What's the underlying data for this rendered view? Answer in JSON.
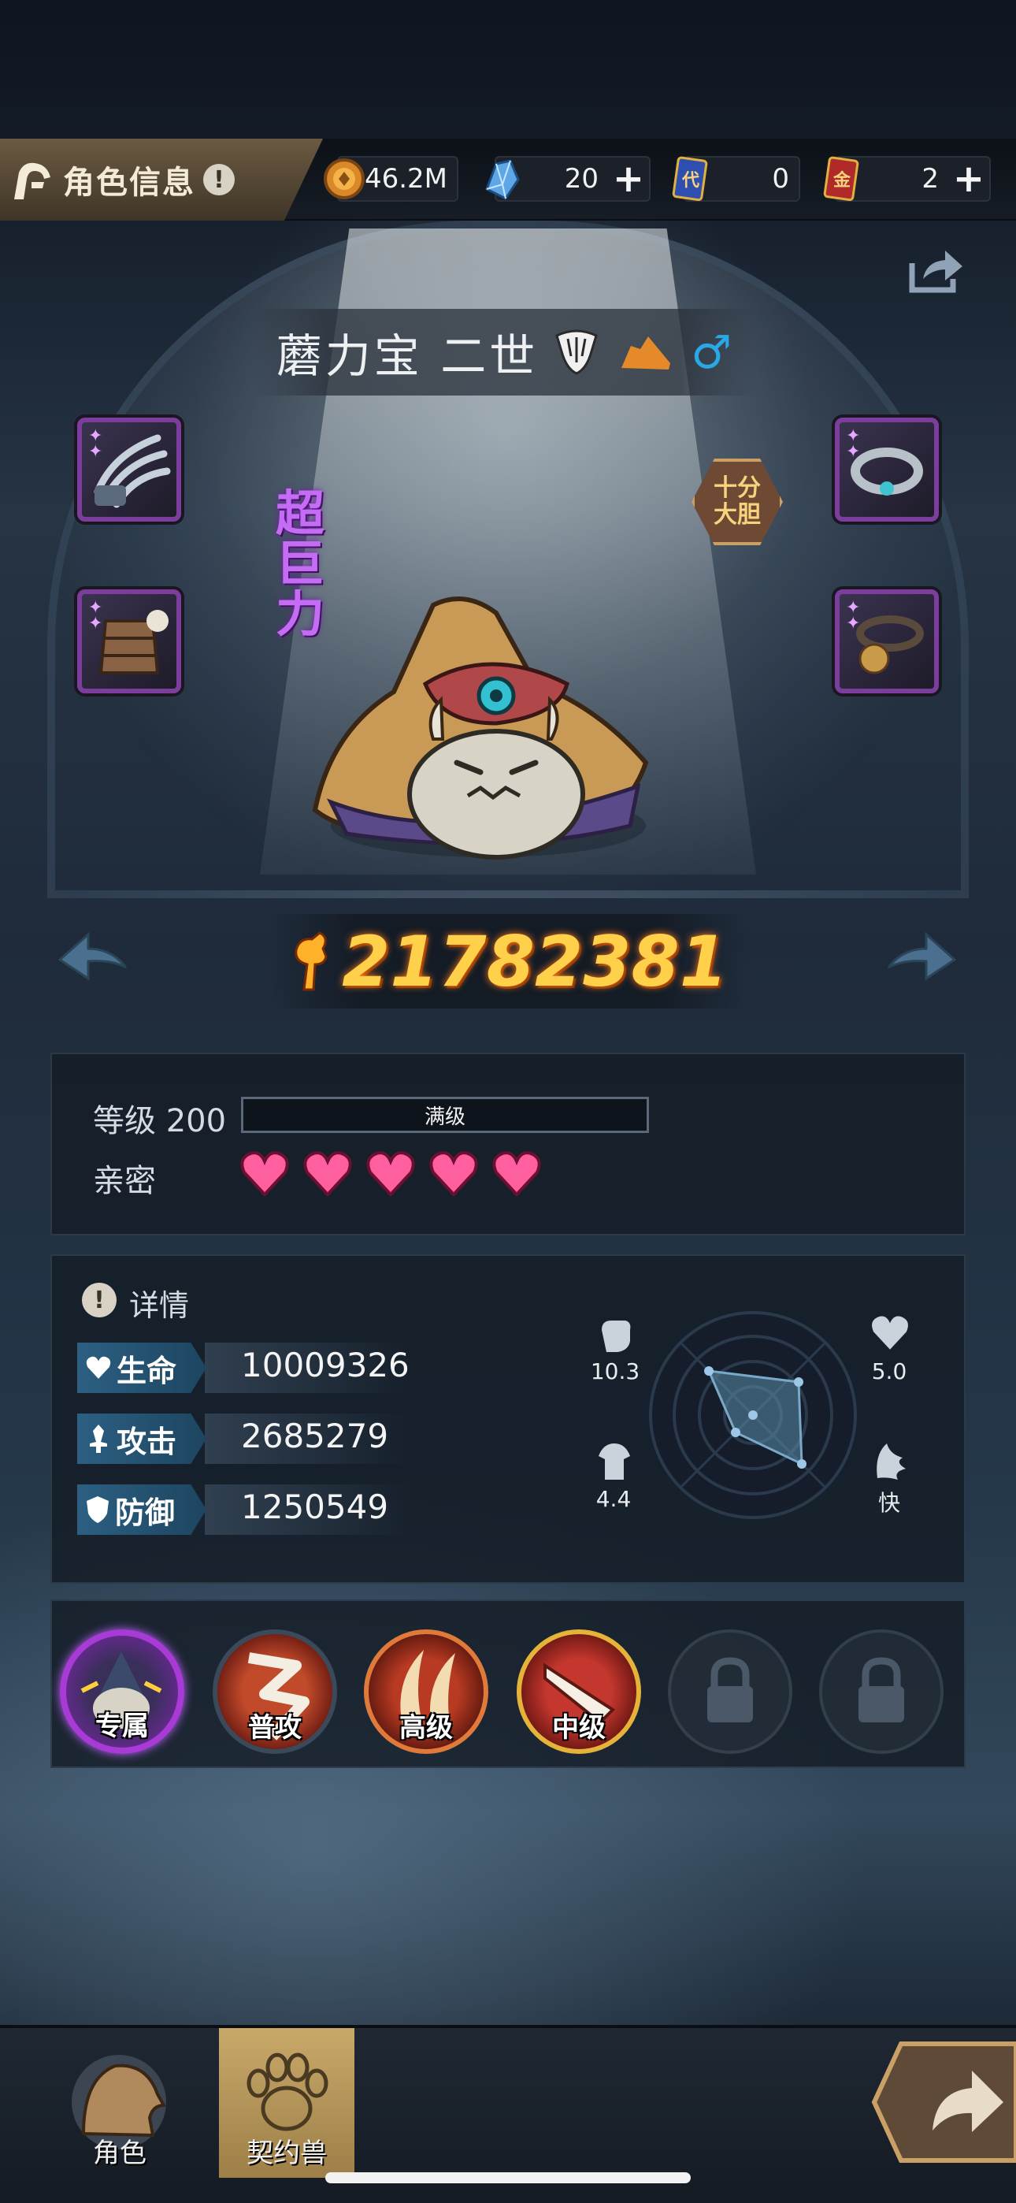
{
  "header": {
    "title": "角色信息",
    "currencies": [
      {
        "icon": "gold-coin-icon",
        "value": "46.2M",
        "has_plus": false
      },
      {
        "icon": "blue-crystal-icon",
        "value": "20",
        "has_plus": true
      },
      {
        "icon": "blue-ticket-icon",
        "ticket_text": "代",
        "value": "0",
        "has_plus": false
      },
      {
        "icon": "red-ticket-icon",
        "ticket_text": "金",
        "value": "2",
        "has_plus": true
      }
    ]
  },
  "pet": {
    "name": "蘑力宝 二世",
    "trait_vertical": [
      "超",
      "巨",
      "力"
    ],
    "trait_badge": "十分\n大胆",
    "power": "21782381"
  },
  "level": {
    "label": "等级 200",
    "bar_text": "满级",
    "fill": 1.0
  },
  "intimacy": {
    "label": "亲密",
    "hearts": 5
  },
  "details": {
    "title": "详情",
    "stats": [
      {
        "name": "生命",
        "icon": "heart-icon",
        "value": "10009326"
      },
      {
        "name": "攻击",
        "icon": "sword-icon",
        "value": "2685279"
      },
      {
        "name": "防御",
        "icon": "shield-icon",
        "value": "1250549"
      }
    ],
    "radar": {
      "top_left": {
        "icon": "fist-icon",
        "value": "10.3"
      },
      "top_right": {
        "icon": "heart-icon",
        "value": "5.0"
      },
      "bottom_left": {
        "icon": "armor-icon",
        "value": "4.4"
      },
      "bottom_right": {
        "icon": "wing-icon",
        "value": "快"
      }
    }
  },
  "skills": [
    {
      "label": "专属",
      "locked": false
    },
    {
      "label": "普攻",
      "locked": false
    },
    {
      "label": "高级",
      "locked": false
    },
    {
      "label": "中级",
      "locked": false
    },
    {
      "label": "",
      "locked": true
    },
    {
      "label": "",
      "locked": true
    }
  ],
  "bottom_nav": [
    {
      "label": "角色",
      "active": false
    },
    {
      "label": "契约兽",
      "active": true
    }
  ],
  "colors": {
    "accent_gold": "#ffd04a",
    "slot_purple": "#7b3e9c",
    "stat_blue": "#2c5f82",
    "heart_pink": "#ff5f9e"
  }
}
